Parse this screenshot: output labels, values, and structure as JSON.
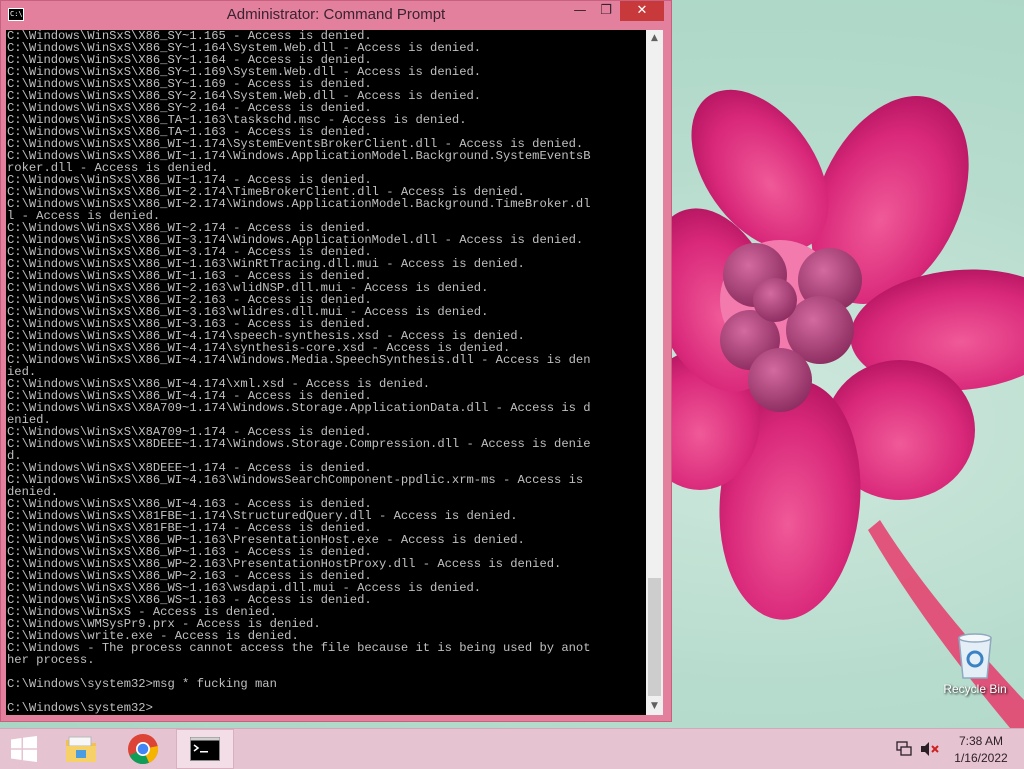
{
  "window": {
    "title": "Administrator: Command Prompt",
    "icon_label": "C:\\",
    "minimize_icon": "minimize-icon",
    "maximize_icon": "restore-icon",
    "close_icon": "close-icon"
  },
  "console": {
    "lines": [
      "C:\\Windows\\WinSxS\\X86_SY~1.165 - Access is denied.",
      "C:\\Windows\\WinSxS\\X86_SY~1.164\\System.Web.dll - Access is denied.",
      "C:\\Windows\\WinSxS\\X86_SY~1.164 - Access is denied.",
      "C:\\Windows\\WinSxS\\X86_SY~1.169\\System.Web.dll - Access is denied.",
      "C:\\Windows\\WinSxS\\X86_SY~1.169 - Access is denied.",
      "C:\\Windows\\WinSxS\\X86_SY~2.164\\System.Web.dll - Access is denied.",
      "C:\\Windows\\WinSxS\\X86_SY~2.164 - Access is denied.",
      "C:\\Windows\\WinSxS\\X86_TA~1.163\\taskschd.msc - Access is denied.",
      "C:\\Windows\\WinSxS\\X86_TA~1.163 - Access is denied.",
      "C:\\Windows\\WinSxS\\X86_WI~1.174\\SystemEventsBrokerClient.dll - Access is denied.",
      "C:\\Windows\\WinSxS\\X86_WI~1.174\\Windows.ApplicationModel.Background.SystemEventsB",
      "roker.dll - Access is denied.",
      "C:\\Windows\\WinSxS\\X86_WI~1.174 - Access is denied.",
      "C:\\Windows\\WinSxS\\X86_WI~2.174\\TimeBrokerClient.dll - Access is denied.",
      "C:\\Windows\\WinSxS\\X86_WI~2.174\\Windows.ApplicationModel.Background.TimeBroker.dl",
      "l - Access is denied.",
      "C:\\Windows\\WinSxS\\X86_WI~2.174 - Access is denied.",
      "C:\\Windows\\WinSxS\\X86_WI~3.174\\Windows.ApplicationModel.dll - Access is denied.",
      "C:\\Windows\\WinSxS\\X86_WI~3.174 - Access is denied.",
      "C:\\Windows\\WinSxS\\X86_WI~1.163\\WinRtTracing.dll.mui - Access is denied.",
      "C:\\Windows\\WinSxS\\X86_WI~1.163 - Access is denied.",
      "C:\\Windows\\WinSxS\\X86_WI~2.163\\wlidNSP.dll.mui - Access is denied.",
      "C:\\Windows\\WinSxS\\X86_WI~2.163 - Access is denied.",
      "C:\\Windows\\WinSxS\\X86_WI~3.163\\wlidres.dll.mui - Access is denied.",
      "C:\\Windows\\WinSxS\\X86_WI~3.163 - Access is denied.",
      "C:\\Windows\\WinSxS\\X86_WI~4.174\\speech-synthesis.xsd - Access is denied.",
      "C:\\Windows\\WinSxS\\X86_WI~4.174\\synthesis-core.xsd - Access is denied.",
      "C:\\Windows\\WinSxS\\X86_WI~4.174\\Windows.Media.SpeechSynthesis.dll - Access is den",
      "ied.",
      "C:\\Windows\\WinSxS\\X86_WI~4.174\\xml.xsd - Access is denied.",
      "C:\\Windows\\WinSxS\\X86_WI~4.174 - Access is denied.",
      "C:\\Windows\\WinSxS\\X8A709~1.174\\Windows.Storage.ApplicationData.dll - Access is d",
      "enied.",
      "C:\\Windows\\WinSxS\\X8A709~1.174 - Access is denied.",
      "C:\\Windows\\WinSxS\\X8DEEE~1.174\\Windows.Storage.Compression.dll - Access is denie",
      "d.",
      "C:\\Windows\\WinSxS\\X8DEEE~1.174 - Access is denied.",
      "C:\\Windows\\WinSxS\\X86_WI~4.163\\WindowsSearchComponent-ppdlic.xrm-ms - Access is",
      "denied.",
      "C:\\Windows\\WinSxS\\X86_WI~4.163 - Access is denied.",
      "C:\\Windows\\WinSxS\\X81FBE~1.174\\StructuredQuery.dll - Access is denied.",
      "C:\\Windows\\WinSxS\\X81FBE~1.174 - Access is denied.",
      "C:\\Windows\\WinSxS\\X86_WP~1.163\\PresentationHost.exe - Access is denied.",
      "C:\\Windows\\WinSxS\\X86_WP~1.163 - Access is denied.",
      "C:\\Windows\\WinSxS\\X86_WP~2.163\\PresentationHostProxy.dll - Access is denied.",
      "C:\\Windows\\WinSxS\\X86_WP~2.163 - Access is denied.",
      "C:\\Windows\\WinSxS\\X86_WS~1.163\\wsdapi.dll.mui - Access is denied.",
      "C:\\Windows\\WinSxS\\X86_WS~1.163 - Access is denied.",
      "C:\\Windows\\WinSxS - Access is denied.",
      "C:\\Windows\\WMSysPr9.prx - Access is denied.",
      "C:\\Windows\\write.exe - Access is denied.",
      "C:\\Windows - The process cannot access the file because it is being used by anot",
      "her process.",
      "",
      "C:\\Windows\\system32>msg * fucking man",
      "",
      "C:\\Windows\\system32>"
    ]
  },
  "desktop": {
    "recycle_bin_label": "Recycle Bin"
  },
  "taskbar": {
    "start_icon": "windows-logo-icon",
    "explorer_icon": "file-explorer-icon",
    "chrome_icon": "chrome-icon",
    "cmd_icon": "command-prompt-icon",
    "network_icon": "network-icon",
    "volume_icon": "volume-muted-icon",
    "clock_time": "7:38 AM",
    "clock_date": "1/16/2022"
  }
}
